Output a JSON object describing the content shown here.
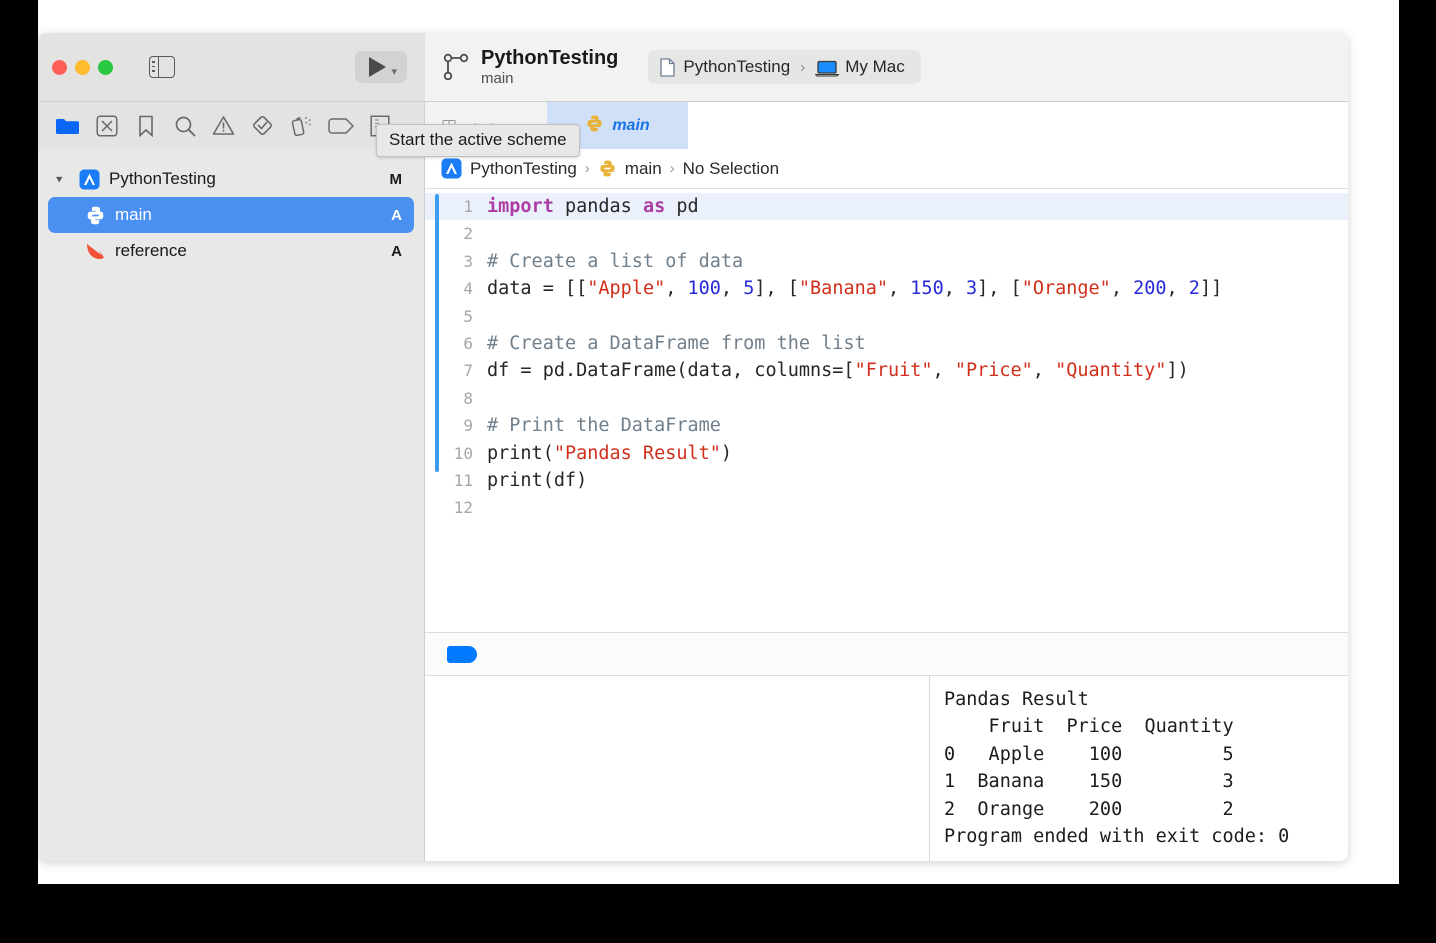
{
  "window": {
    "traffic_lights": [
      "close",
      "minimize",
      "zoom"
    ],
    "colors": {
      "red": "#ff5f57",
      "yellow": "#febc2e",
      "green": "#28c840",
      "accent_blue": "#007aff",
      "selection_blue": "#4a90f0"
    }
  },
  "toolbar": {
    "sidebar_toggle_name": "Hide or show the Navigator",
    "run_button_label": "Run",
    "scheme": {
      "title": "PythonTesting",
      "branch": "main"
    },
    "destination": {
      "scheme_name": "PythonTesting",
      "separator": "›",
      "device": "My Mac"
    }
  },
  "tooltip": {
    "text": "Start the active scheme"
  },
  "navigator_tabs": [
    {
      "name": "project-navigator",
      "icon": "folder-icon",
      "active": true
    },
    {
      "name": "source-control-navigator",
      "icon": "x-box-icon",
      "active": false
    },
    {
      "name": "bookmark-navigator",
      "icon": "bookmark-icon",
      "active": false
    },
    {
      "name": "find-navigator",
      "icon": "search-icon",
      "active": false
    },
    {
      "name": "issue-navigator",
      "icon": "warning-triangle-icon",
      "active": false
    },
    {
      "name": "test-navigator",
      "icon": "diamond-check-icon",
      "active": false
    },
    {
      "name": "debug-navigator",
      "icon": "spray-can-icon",
      "active": false
    },
    {
      "name": "breakpoint-navigator",
      "icon": "tag-icon",
      "active": false
    },
    {
      "name": "report-navigator",
      "icon": "report-icon",
      "active": false
    }
  ],
  "tabs": [
    {
      "label": "main",
      "active": true,
      "icon": "python-icon"
    }
  ],
  "navigator": {
    "items": [
      {
        "label": "PythonTesting",
        "status": "M",
        "icon": "xcode-project-icon",
        "level": 0,
        "expanded": true,
        "selected": false
      },
      {
        "label": "main",
        "status": "A",
        "icon": "python-icon",
        "level": 1,
        "selected": true
      },
      {
        "label": "reference",
        "status": "A",
        "icon": "swift-icon",
        "level": 1,
        "selected": false
      }
    ]
  },
  "jumpbar": {
    "crumbs": [
      "PythonTesting",
      "main",
      "No Selection"
    ],
    "separator": "›"
  },
  "editor": {
    "filename": "main",
    "lines": [
      {
        "n": "1",
        "highlighted": true,
        "tokens": [
          {
            "t": "import",
            "c": "kw"
          },
          {
            "t": " pandas ",
            "c": ""
          },
          {
            "t": "as",
            "c": "kw"
          },
          {
            "t": " pd",
            "c": ""
          }
        ]
      },
      {
        "n": "2",
        "highlighted": false,
        "tokens": []
      },
      {
        "n": "3",
        "highlighted": false,
        "tokens": [
          {
            "t": "# Create a list of data",
            "c": "cmt"
          }
        ]
      },
      {
        "n": "4",
        "highlighted": false,
        "tokens": [
          {
            "t": "data = [[",
            "c": ""
          },
          {
            "t": "\"Apple\"",
            "c": "str"
          },
          {
            "t": ", ",
            "c": ""
          },
          {
            "t": "100",
            "c": "num"
          },
          {
            "t": ", ",
            "c": ""
          },
          {
            "t": "5",
            "c": "num"
          },
          {
            "t": "], [",
            "c": ""
          },
          {
            "t": "\"Banana\"",
            "c": "str"
          },
          {
            "t": ", ",
            "c": ""
          },
          {
            "t": "150",
            "c": "num"
          },
          {
            "t": ", ",
            "c": ""
          },
          {
            "t": "3",
            "c": "num"
          },
          {
            "t": "], [",
            "c": ""
          },
          {
            "t": "\"Orange\"",
            "c": "str"
          },
          {
            "t": ", ",
            "c": ""
          },
          {
            "t": "200",
            "c": "num"
          },
          {
            "t": ", ",
            "c": ""
          },
          {
            "t": "2",
            "c": "num"
          },
          {
            "t": "]]",
            "c": ""
          }
        ]
      },
      {
        "n": "5",
        "highlighted": false,
        "tokens": []
      },
      {
        "n": "6",
        "highlighted": false,
        "tokens": [
          {
            "t": "# Create a DataFrame from the list",
            "c": "cmt"
          }
        ]
      },
      {
        "n": "7",
        "highlighted": false,
        "tokens": [
          {
            "t": "df = pd.DataFrame(data, columns=[",
            "c": ""
          },
          {
            "t": "\"Fruit\"",
            "c": "str"
          },
          {
            "t": ", ",
            "c": ""
          },
          {
            "t": "\"Price\"",
            "c": "str"
          },
          {
            "t": ", ",
            "c": ""
          },
          {
            "t": "\"Quantity\"",
            "c": "str"
          },
          {
            "t": "])",
            "c": ""
          }
        ]
      },
      {
        "n": "8",
        "highlighted": false,
        "tokens": []
      },
      {
        "n": "9",
        "highlighted": false,
        "tokens": [
          {
            "t": "# Print the DataFrame",
            "c": "cmt"
          }
        ]
      },
      {
        "n": "10",
        "highlighted": false,
        "tokens": [
          {
            "t": "print(",
            "c": ""
          },
          {
            "t": "\"Pandas Result\"",
            "c": "str"
          },
          {
            "t": ")",
            "c": ""
          }
        ]
      },
      {
        "n": "11",
        "highlighted": false,
        "tokens": [
          {
            "t": "print(df)",
            "c": ""
          }
        ]
      },
      {
        "n": "12",
        "highlighted": false,
        "tokens": []
      }
    ]
  },
  "debug_bar": {
    "breakpoint_enabled": true
  },
  "console": {
    "output": "Pandas Result\n    Fruit  Price  Quantity\n0   Apple    100         5\n1  Banana    150         3\n2  Orange    200         2\nProgram ended with exit code: 0"
  }
}
